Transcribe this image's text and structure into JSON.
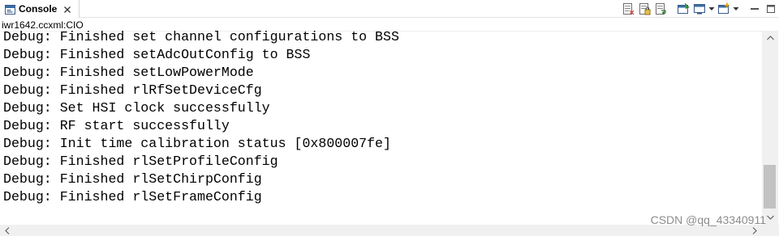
{
  "tab": {
    "label": "Console",
    "icon": "console-icon",
    "close_icon": "close-icon"
  },
  "toolbar": {
    "icons": [
      "clear-console-icon",
      "scroll-lock-icon",
      "word-wrap-icon",
      "pin-console-icon",
      "display-console-icon",
      "open-console-icon",
      "minimize-icon",
      "maximize-icon"
    ]
  },
  "subheader": {
    "title": "iwr1642.ccxml:CIO"
  },
  "console": {
    "lines": [
      "Debug: Finished set channel configurations to BSS",
      "Debug: Finished setAdcOutConfig to BSS",
      "Debug: Finished setLowPowerMode",
      "Debug: Finished rlRfSetDeviceCfg",
      "Debug: Set HSI clock successfully",
      "Debug: RF start successfully",
      "Debug: Init time calibration status [0x800007fe]",
      "Debug: Finished rlSetProfileConfig",
      "Debug: Finished rlSetChirpConfig",
      "Debug: Finished rlSetFrameConfig"
    ]
  },
  "watermark": "CSDN @qq_43340911",
  "colors": {
    "background": "#ffffff",
    "scrollbar_track": "#f0f0f0",
    "scrollbar_thumb": "#c2c2c2",
    "watermark": "#8c8c8c"
  }
}
